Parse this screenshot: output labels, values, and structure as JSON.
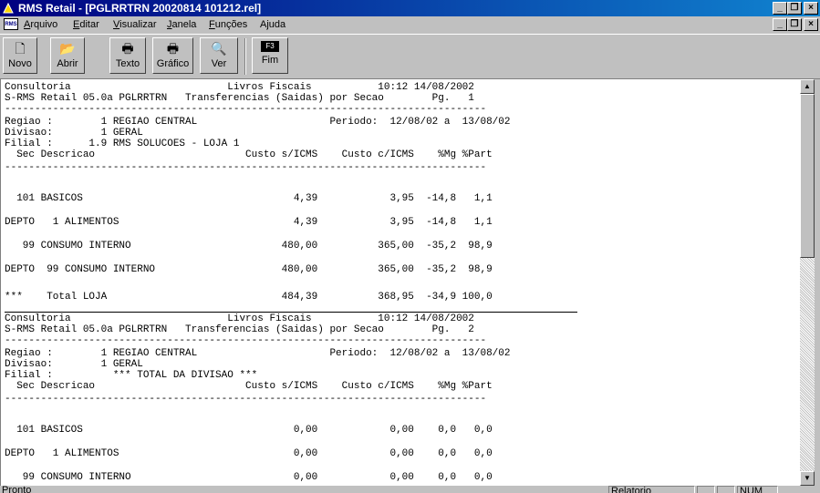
{
  "titlebar": {
    "title": "RMS Retail - [PGLRRTRN 20020814 101212.rel]",
    "minimize": "_",
    "restore": "❐",
    "close": "×"
  },
  "menubar": {
    "doc_icon": "RMS",
    "items": [
      "Arquivo",
      "Editar",
      "Visualizar",
      "Janela",
      "Funções",
      "Ajuda"
    ]
  },
  "toolbar": {
    "buttons": [
      {
        "label": "Novo",
        "icon": "new-document-icon"
      },
      {
        "label": "Abrir",
        "icon": "open-folder-icon"
      },
      {
        "label": "Texto",
        "icon": "printer-icon"
      },
      {
        "label": "Gráfico",
        "icon": "printer-icon"
      },
      {
        "label": "Ver",
        "icon": "preview-icon"
      },
      {
        "label": "Fim",
        "key": "F3"
      }
    ]
  },
  "report": {
    "lines": [
      "Consultoria                          Livros Fiscais           10:12 14/08/2002",
      "S-RMS Retail 05.0a PGLRRTRN   Transferencias (Saidas) por Secao        Pg.   1",
      "--------------------------------------------------------------------------------",
      "Regiao :        1 REGIAO CENTRAL                      Periodo:  12/08/02 a  13/08/02",
      "Divisao:        1 GERAL",
      "Filial :      1.9 RMS SOLUCOES - LOJA 1",
      "  Sec Descricao                         Custo s/ICMS    Custo c/ICMS    %Mg %Part",
      "--------------------------------------------------------------------------------",
      "",
      "  101 BASICOS                                   4,39            3,95  -14,8   1,1",
      "",
      "DEPTO   1 ALIMENTOS                             4,39            3,95  -14,8   1,1",
      "",
      "   99 CONSUMO INTERNO                         480,00          365,00  -35,2  98,9",
      "",
      "DEPTO  99 CONSUMO INTERNO                     480,00          365,00  -35,2  98,9",
      "",
      "***    Total LOJA                             484,39          368,95  -34,9 100,0",
      "Consultoria                          Livros Fiscais           10:12 14/08/2002",
      "S-RMS Retail 05.0a PGLRRTRN   Transferencias (Saidas) por Secao        Pg.   2",
      "--------------------------------------------------------------------------------",
      "Regiao :        1 REGIAO CENTRAL                      Periodo:  12/08/02 a  13/08/02",
      "Divisao:        1 GERAL",
      "Filial :          *** TOTAL DA DIVISAO ***",
      "  Sec Descricao                         Custo s/ICMS    Custo c/ICMS    %Mg %Part",
      "--------------------------------------------------------------------------------",
      "",
      "  101 BASICOS                                   0,00            0,00    0,0   0,0",
      "",
      "DEPTO   1 ALIMENTOS                             0,00            0,00    0,0   0,0",
      "",
      "   99 CONSUMO INTERNO                           0,00            0,00    0,0   0,0"
    ]
  },
  "statusbar": {
    "left": "Pronto",
    "panel1": "Relatorio",
    "panel2": "",
    "panel3": "",
    "panel4": "NUM"
  },
  "colors": {
    "titlebar_start": "#000080",
    "titlebar_end": "#1084d0",
    "face": "#c0c0c0"
  }
}
